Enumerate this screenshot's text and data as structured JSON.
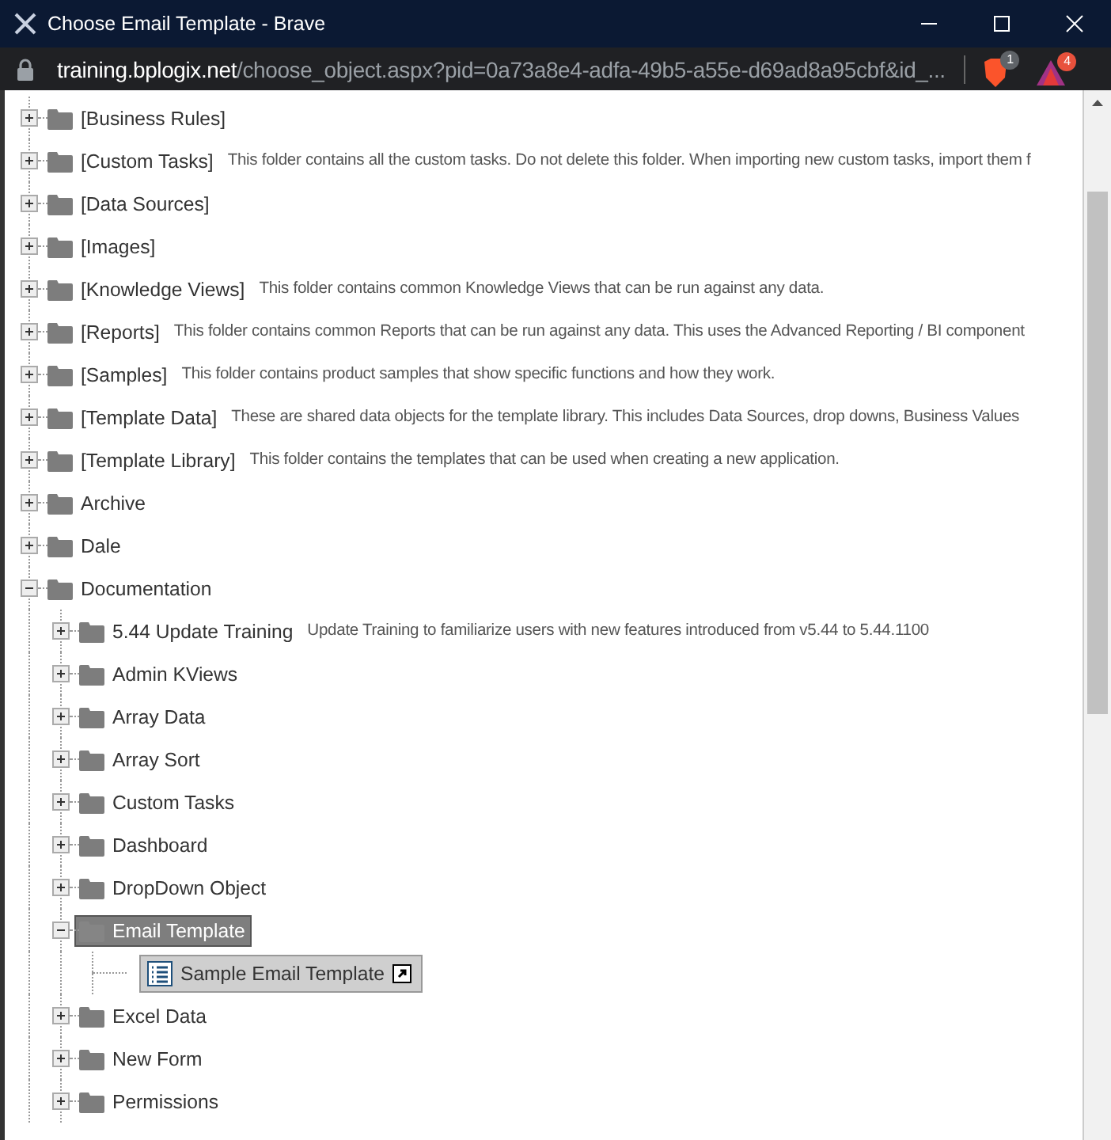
{
  "window": {
    "title": "Choose Email Template - Brave"
  },
  "address_bar": {
    "host": "training.bplogix.net",
    "path": "/choose_object.aspx?pid=0a73a8e4-adfa-49b5-a55e-d69ad8a95cbf&id_...",
    "shields_badge": "1",
    "rewards_badge": "4"
  },
  "tree": [
    {
      "kind": "folder",
      "label": "[Business Rules]",
      "expanded": false,
      "selected": false
    },
    {
      "kind": "folder",
      "label": "[Custom Tasks]",
      "description": "This folder contains all the custom tasks. Do not delete this folder. When importing new custom tasks, import them f",
      "expanded": false,
      "selected": false
    },
    {
      "kind": "folder",
      "label": "[Data Sources]",
      "expanded": false,
      "selected": false
    },
    {
      "kind": "folder",
      "label": "[Images]",
      "expanded": false,
      "selected": false
    },
    {
      "kind": "folder",
      "label": "[Knowledge Views]",
      "description": "This folder contains common Knowledge Views that can be run against any data.",
      "expanded": false,
      "selected": false
    },
    {
      "kind": "folder",
      "label": "[Reports]",
      "description": "This folder contains common Reports that can be run against any data. This uses the Advanced Reporting / BI component",
      "expanded": false,
      "selected": false
    },
    {
      "kind": "folder",
      "label": "[Samples]",
      "description": "This folder contains product samples that show specific functions and how they work.",
      "expanded": false,
      "selected": false
    },
    {
      "kind": "folder",
      "label": "[Template Data]",
      "description": "These are shared data objects for the template library. This includes Data Sources, drop downs, Business Values",
      "expanded": false,
      "selected": false
    },
    {
      "kind": "folder",
      "label": "[Template Library]",
      "description": "This folder contains the templates that can be used when creating a new application.",
      "expanded": false,
      "selected": false
    },
    {
      "kind": "folder",
      "label": "Archive",
      "expanded": false,
      "selected": false
    },
    {
      "kind": "folder",
      "label": "Dale",
      "expanded": false,
      "selected": false
    },
    {
      "kind": "folder",
      "label": "Documentation",
      "expanded": true,
      "selected": false,
      "children": [
        {
          "kind": "folder",
          "label": "5.44 Update Training",
          "description": "Update Training to familiarize users with new features introduced from v5.44 to 5.44.1100",
          "expanded": false,
          "selected": false
        },
        {
          "kind": "folder",
          "label": "Admin KViews",
          "expanded": false,
          "selected": false
        },
        {
          "kind": "folder",
          "label": "Array Data",
          "expanded": false,
          "selected": false
        },
        {
          "kind": "folder",
          "label": "Array Sort",
          "expanded": false,
          "selected": false
        },
        {
          "kind": "folder",
          "label": "Custom Tasks",
          "expanded": false,
          "selected": false
        },
        {
          "kind": "folder",
          "label": "Dashboard",
          "expanded": false,
          "selected": false
        },
        {
          "kind": "folder",
          "label": "DropDown Object",
          "expanded": false,
          "selected": false
        },
        {
          "kind": "folder",
          "label": "Email Template",
          "expanded": true,
          "selected": true,
          "children": [
            {
              "kind": "item",
              "label": "Sample Email Template",
              "selected": true
            }
          ]
        },
        {
          "kind": "folder",
          "label": "Excel Data",
          "expanded": false,
          "selected": false
        },
        {
          "kind": "folder",
          "label": "New Form",
          "expanded": false,
          "selected": false
        },
        {
          "kind": "folder",
          "label": "Permissions",
          "expanded": false,
          "selected": false
        }
      ]
    }
  ]
}
